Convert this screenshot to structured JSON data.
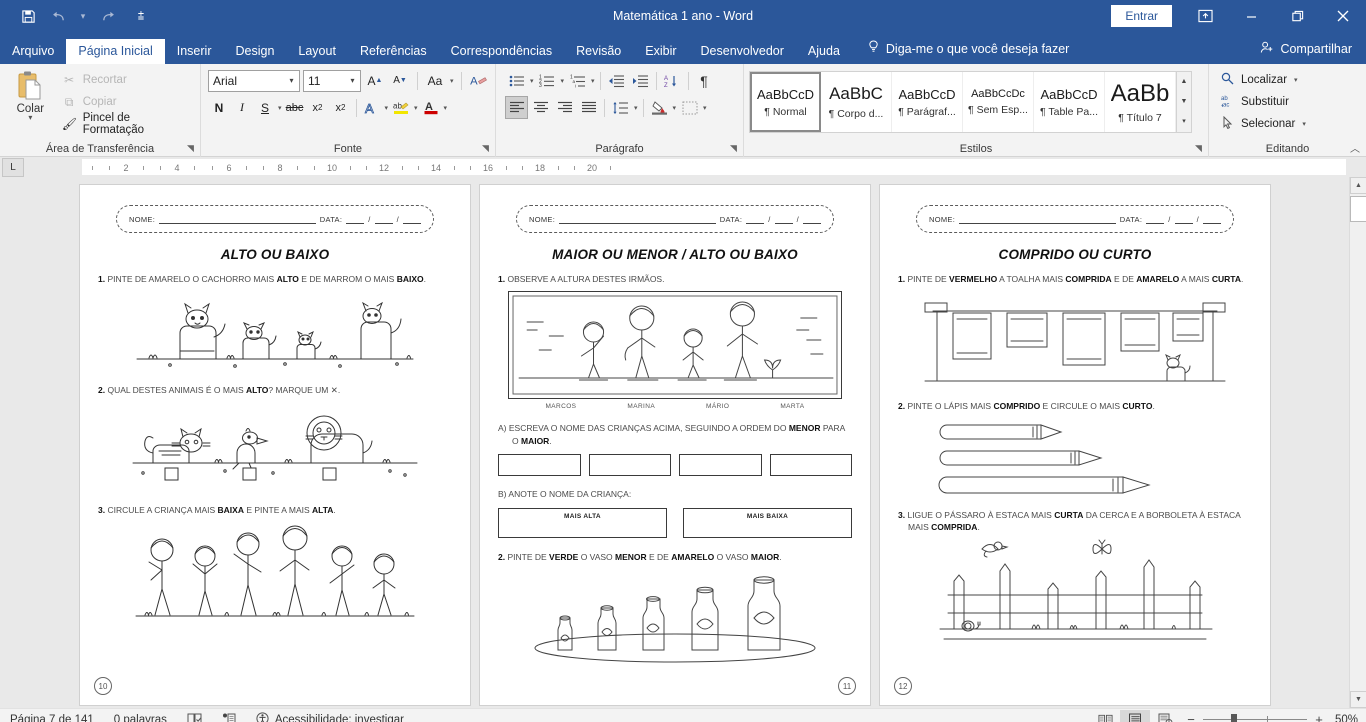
{
  "window": {
    "title": "Matemática 1 ano  -  Word",
    "signin_label": "Entrar",
    "ribbon_display_icon": "ribbon-display-options-icon",
    "minimize_icon": "minimize-icon",
    "restore_icon": "restore-icon",
    "close_icon": "close-icon"
  },
  "quick_access": {
    "save_icon": "save-icon",
    "undo_icon": "undo-icon",
    "undo_caret_icon": "chevron-down-icon",
    "redo_icon": "redo-icon",
    "customize_icon": "chevron-down-icon"
  },
  "tabs": [
    {
      "label": "Arquivo",
      "active": false
    },
    {
      "label": "Página Inicial",
      "active": true
    },
    {
      "label": "Inserir",
      "active": false
    },
    {
      "label": "Design",
      "active": false
    },
    {
      "label": "Layout",
      "active": false
    },
    {
      "label": "Referências",
      "active": false
    },
    {
      "label": "Correspondências",
      "active": false
    },
    {
      "label": "Revisão",
      "active": false
    },
    {
      "label": "Exibir",
      "active": false
    },
    {
      "label": "Desenvolvedor",
      "active": false
    },
    {
      "label": "Ajuda",
      "active": false
    }
  ],
  "tellme": {
    "label": "Diga-me o que você deseja fazer",
    "icon": "lightbulb-icon"
  },
  "share": {
    "label": "Compartilhar",
    "icon": "share-person-icon"
  },
  "ribbon": {
    "clipboard": {
      "group_label": "Área de Transferência",
      "paste_label": "Colar",
      "items": [
        {
          "label": "Recortar",
          "icon": "scissors-icon",
          "enabled": false
        },
        {
          "label": "Copiar",
          "icon": "copy-icon",
          "enabled": false
        },
        {
          "label": "Pincel de Formatação",
          "icon": "format-painter-icon",
          "enabled": true
        }
      ]
    },
    "font": {
      "group_label": "Fonte",
      "font_family": "Arial",
      "font_size": "11",
      "buttons_row1": [
        {
          "name": "grow-font-icon",
          "glyph": "A"
        },
        {
          "name": "shrink-font-icon",
          "glyph": "A"
        },
        {
          "name": "change-case-icon",
          "glyph": "Aa"
        },
        {
          "name": "clear-formatting-icon",
          "glyph": "A"
        }
      ],
      "buttons_row2": [
        {
          "name": "bold-button",
          "glyph": "N"
        },
        {
          "name": "italic-button",
          "glyph": "I"
        },
        {
          "name": "underline-button",
          "glyph": "S"
        },
        {
          "name": "strikethrough-button",
          "glyph": "abc"
        },
        {
          "name": "subscript-button",
          "glyph": "x"
        },
        {
          "name": "superscript-button",
          "glyph": "x"
        },
        {
          "name": "text-effects-button",
          "glyph": "A"
        },
        {
          "name": "text-highlight-color-button",
          "glyph": "ab"
        },
        {
          "name": "font-color-button",
          "glyph": "A"
        }
      ]
    },
    "paragraph": {
      "group_label": "Parágrafo",
      "buttons_row1": [
        "bullet-list-icon",
        "numbered-list-icon",
        "multilevel-list-icon",
        "decrease-indent-icon",
        "increase-indent-icon",
        "sort-icon",
        "show-marks-icon"
      ],
      "buttons_row2": [
        "align-left-icon",
        "align-center-icon",
        "align-right-icon",
        "justify-icon",
        "line-spacing-icon",
        "shading-icon",
        "borders-icon"
      ]
    },
    "styles": {
      "group_label": "Estilos",
      "items": [
        {
          "preview": "AaBbCcD",
          "name": "¶ Normal",
          "selected": true
        },
        {
          "preview": "AaBbC",
          "name": "¶ Corpo d...",
          "selected": false
        },
        {
          "preview": "AaBbCcD",
          "name": "¶ Parágraf...",
          "selected": false
        },
        {
          "preview": "AaBbCcDc",
          "name": "¶ Sem Esp...",
          "selected": false
        },
        {
          "preview": "AaBbCcD",
          "name": "¶ Table Pa...",
          "selected": false
        },
        {
          "preview": "AaBb",
          "name": "¶ Título 7",
          "selected": false
        }
      ]
    },
    "editing": {
      "group_label": "Editando",
      "items": [
        {
          "label": "Localizar",
          "icon": "search-icon",
          "has_caret": true
        },
        {
          "label": "Substituir",
          "icon": "replace-icon",
          "has_caret": false
        },
        {
          "label": "Selecionar",
          "icon": "cursor-select-icon",
          "has_caret": true
        }
      ]
    },
    "collapse_icon": "chevron-up-icon"
  },
  "ruler": {
    "tab_selector_glyph": "L",
    "ticks": [
      "2",
      "4",
      "6",
      "8",
      "10",
      "12",
      "14",
      "16",
      "18",
      "20"
    ]
  },
  "document": {
    "header_fields": {
      "name_label": "NOME:",
      "date_label": "DATA:"
    },
    "pages": [
      {
        "number": "10",
        "number_side": "left",
        "title": "ALTO OU BAIXO",
        "questions": [
          {
            "num": "1.",
            "text_parts": [
              {
                "t": "PINTE DE AMARELO O CACHORRO MAIS ",
                "b": false
              },
              {
                "t": "ALTO",
                "b": true
              },
              {
                "t": " E DE MARROM O MAIS ",
                "b": false
              },
              {
                "t": "BAIXO",
                "b": true
              },
              {
                "t": ".",
                "b": false
              }
            ],
            "illustration": "dogs-illustration"
          },
          {
            "num": "2.",
            "text_parts": [
              {
                "t": "QUAL DESTES ANIMAIS É O MAIS ",
                "b": false
              },
              {
                "t": "ALTO",
                "b": true
              },
              {
                "t": "? MARQUE UM ✕.",
                "b": false
              }
            ],
            "illustration": "animals-row-illustration"
          },
          {
            "num": "3.",
            "text_parts": [
              {
                "t": "CIRCULE A CRIANÇA MAIS ",
                "b": false
              },
              {
                "t": "BAIXA",
                "b": true
              },
              {
                "t": " E PINTE A MAIS ",
                "b": false
              },
              {
                "t": "ALTA",
                "b": true
              },
              {
                "t": ".",
                "b": false
              }
            ],
            "illustration": "children-group-illustration"
          }
        ]
      },
      {
        "number": "11",
        "number_side": "right",
        "title": "MAIOR OU MENOR / ALTO OU BAIXO",
        "q1_label": "1.",
        "q1_text": "OBSERVE A ALTURA DESTES IRMÃOS.",
        "child_names": [
          "MARCOS",
          "MARINA",
          "MÁRIO",
          "MARTA"
        ],
        "qa_label": "A)",
        "qa_parts": [
          {
            "t": "ESCREVA O NOME DAS CRIANÇAS ACIMA, SEGUINDO A ORDEM DO ",
            "b": false
          },
          {
            "t": "MENOR",
            "b": true
          },
          {
            "t": " PARA O ",
            "b": false
          },
          {
            "t": "MAIOR",
            "b": true
          },
          {
            "t": ".",
            "b": false
          }
        ],
        "answer_boxes": [
          "",
          "",
          "",
          ""
        ],
        "qb_label": "B)",
        "qb_text": "ANOTE O NOME DA CRIANÇA:",
        "answer_boxes2": [
          "MAIS ALTA",
          "MAIS BAIXA"
        ],
        "q2_label": "2.",
        "q2_parts": [
          {
            "t": "PINTE DE ",
            "b": false
          },
          {
            "t": "VERDE",
            "b": true
          },
          {
            "t": " O VASO ",
            "b": false
          },
          {
            "t": "MENOR",
            "b": true
          },
          {
            "t": " E DE ",
            "b": false
          },
          {
            "t": "AMARELO",
            "b": true
          },
          {
            "t": " O VASO ",
            "b": false
          },
          {
            "t": "MAIOR",
            "b": true
          },
          {
            "t": ".",
            "b": false
          }
        ]
      },
      {
        "number": "12",
        "number_side": "left",
        "title": "COMPRIDO OU CURTO",
        "questions": [
          {
            "num": "1.",
            "text_parts": [
              {
                "t": "PINTE DE ",
                "b": false
              },
              {
                "t": "VERMELHO",
                "b": true
              },
              {
                "t": " A TOALHA MAIS ",
                "b": false
              },
              {
                "t": "COMPRIDA",
                "b": true
              },
              {
                "t": " E DE ",
                "b": false
              },
              {
                "t": "AMARELO",
                "b": true
              },
              {
                "t": " A MAIS ",
                "b": false
              },
              {
                "t": "CURTA",
                "b": true
              },
              {
                "t": ".",
                "b": false
              }
            ],
            "illustration": "towels-illustration"
          },
          {
            "num": "2.",
            "text_parts": [
              {
                "t": "PINTE O LÁPIS MAIS ",
                "b": false
              },
              {
                "t": "COMPRIDO",
                "b": true
              },
              {
                "t": " E CIRCULE O MAIS ",
                "b": false
              },
              {
                "t": "CURTO",
                "b": true
              },
              {
                "t": ".",
                "b": false
              }
            ],
            "illustration": "pencils-illustration"
          },
          {
            "num": "3.",
            "text_parts": [
              {
                "t": "LIGUE O PÁSSARO À ESTACA MAIS ",
                "b": false
              },
              {
                "t": "CURTA",
                "b": true
              },
              {
                "t": " DA CERCA E A BORBOLETA À ESTACA MAIS ",
                "b": false
              },
              {
                "t": "COMPRIDA",
                "b": true
              },
              {
                "t": ".",
                "b": false
              }
            ],
            "illustration": "fence-illustration"
          }
        ]
      }
    ]
  },
  "status_bar": {
    "page_info": "Página 7 de 141",
    "word_count": "0 palavras",
    "proofing_icon": "proofing-icon",
    "language_icon": "language-icon",
    "accessibility": "Acessibilidade: investigar",
    "accessibility_icon": "accessibility-icon",
    "views": [
      {
        "name": "read-mode-view",
        "selected": false
      },
      {
        "name": "print-layout-view",
        "selected": true
      },
      {
        "name": "web-layout-view",
        "selected": false
      }
    ],
    "zoom_out_glyph": "−",
    "zoom_in_glyph": "+",
    "zoom_level": "50%"
  },
  "colors": {
    "accent": "#2b579a",
    "ribbon_bg": "#f3f3f3",
    "app_bg": "#e9e9e9",
    "page_bg": "#ffffff"
  }
}
